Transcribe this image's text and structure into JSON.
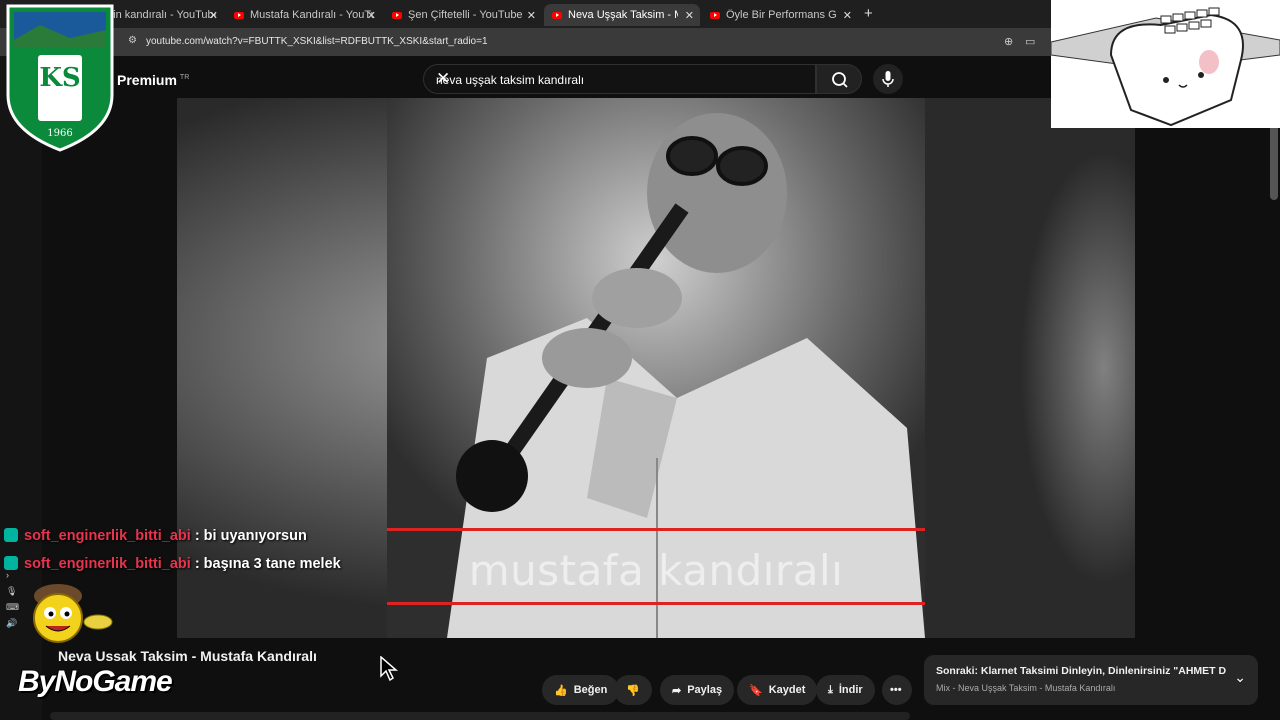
{
  "browser": {
    "tabs": [
      {
        "label": "...in kandıralı - YouTube"
      },
      {
        "label": "Mustafa Kandıralı - YouTube"
      },
      {
        "label": "Şen Çiftetelli - YouTube"
      },
      {
        "label": "Neva Uşşak Taksim - Musta..."
      },
      {
        "label": "Öyle Bir Performans Gösterdi K..."
      }
    ],
    "url": "youtube.com/watch?v=FBUTTK_XSKI&list=RDFBUTTK_XSKI&start_radio=1"
  },
  "youtube": {
    "brand": "Premium",
    "country": "TR",
    "search_value": "neva uşşak taksim kandıralı"
  },
  "video": {
    "album_artist": "mustafa kandıralı",
    "title": "Neva Ussak Taksim - Mustafa Kandıralı"
  },
  "actions": {
    "like": "Beğen",
    "share": "Paylaş",
    "save": "Kaydet",
    "download": "İndir"
  },
  "up_next": {
    "title": "Sonraki: Klarnet Taksimi Dinleyin, Dinlenirsiniz \"AHMET DEM...",
    "subtitle": "Mix - Neva Uşşak Taksim - Mustafa Kandıralı"
  },
  "chat": [
    {
      "user": "soft_enginerlik_bitti_abi",
      "message": ": bi uyanıyorsun"
    },
    {
      "user": "soft_enginerlik_bitti_abi",
      "message": ": başına 3 tane melek"
    }
  ],
  "overlay": {
    "club_logo_letters": "KS",
    "club_logo_year": "1966",
    "sponsor": "ByNoGame",
    "badge_color": "#00b4a0",
    "username_color": "#e8344e"
  }
}
